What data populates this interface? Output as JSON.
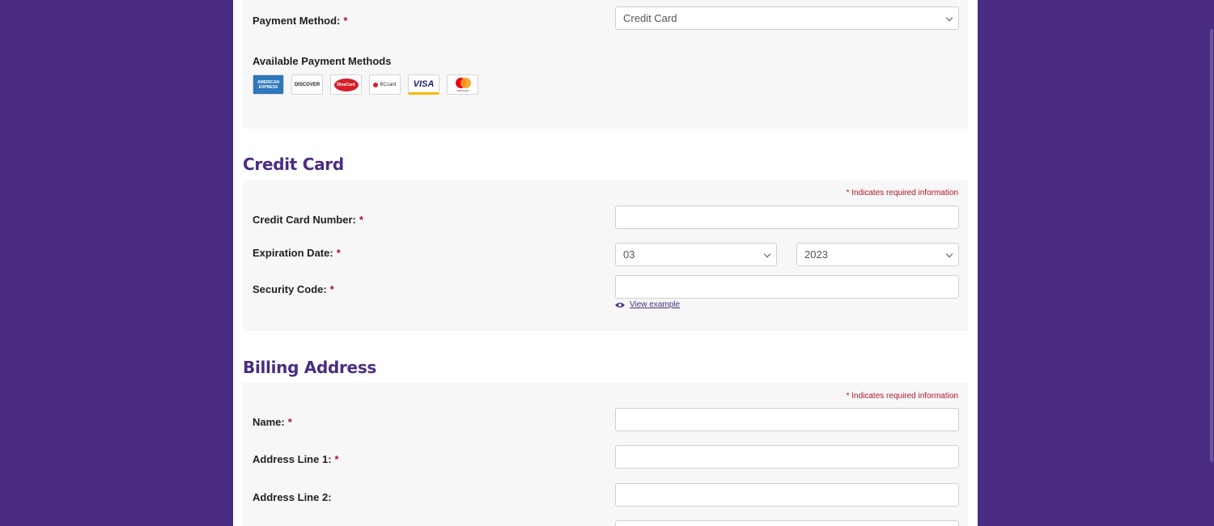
{
  "payment": {
    "label": "Payment Method:",
    "required_mark": "*",
    "selected": "Credit Card",
    "available_title": "Available Payment Methods",
    "logos": [
      {
        "name": "american-express",
        "text": "AMERICAN EXPRESS",
        "bg": "#2e77bb",
        "fg": "#ffffff"
      },
      {
        "name": "discover",
        "text": "DISCOVER",
        "bg": "#ffffff",
        "fg": "#222222"
      },
      {
        "name": "dinacard",
        "text": "DinaCard",
        "bg": "#ffffff",
        "fg": "#d4202a"
      },
      {
        "name": "bccard",
        "text": "BCcard",
        "bg": "#ffffff",
        "fg": "#d4202a"
      },
      {
        "name": "visa",
        "text": "VISA",
        "bg": "#ffffff",
        "fg": "#1a1f71"
      },
      {
        "name": "mastercard",
        "text": "mastercard",
        "bg": "#ffffff",
        "fg": "#222222"
      }
    ]
  },
  "credit_card": {
    "title": "Credit Card",
    "required_note": "* Indicates required information",
    "number_label": "Credit Card Number:",
    "number_value": "",
    "exp_label": "Expiration Date:",
    "exp_month": "03",
    "exp_year": "2023",
    "cvv_label": "Security Code:",
    "cvv_value": "",
    "view_example": "View example"
  },
  "billing": {
    "title": "Billing Address",
    "required_note": "* Indicates required information",
    "name_label": "Name:",
    "addr1_label": "Address Line 1:",
    "addr2_label": "Address Line 2:"
  },
  "colors": {
    "brand": "#4a2d82",
    "required": "#b0162a",
    "panel": "#f7f7f7"
  }
}
